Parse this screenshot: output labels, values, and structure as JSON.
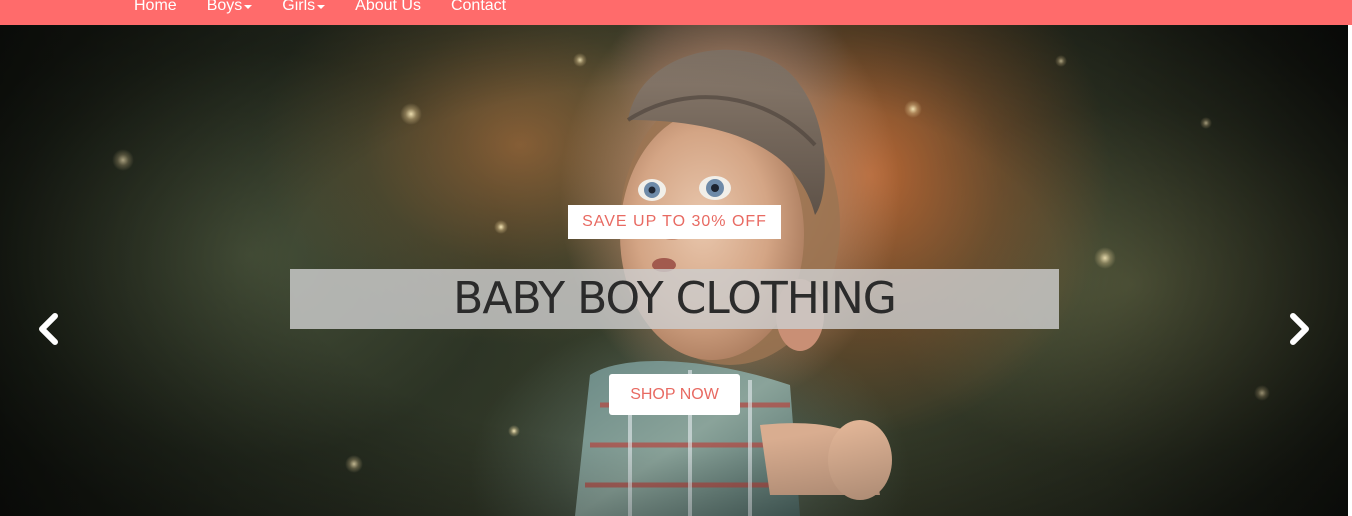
{
  "colors": {
    "nav_background": "#ff6b6b",
    "accent_text": "#e86a62",
    "nav_text": "#ffffff"
  },
  "nav": {
    "items": [
      {
        "label": "Home",
        "dropdown": false
      },
      {
        "label": "Boys",
        "dropdown": true
      },
      {
        "label": "Girls",
        "dropdown": true
      },
      {
        "label": "About Us",
        "dropdown": false
      },
      {
        "label": "Contact",
        "dropdown": false
      }
    ]
  },
  "hero": {
    "badge_text": "SAVE UP TO 30% OFF",
    "headline": "BABY BOY CLOTHING",
    "cta_label": "SHOP NOW",
    "prev_icon": "chevron-left-icon",
    "next_icon": "chevron-right-icon"
  }
}
